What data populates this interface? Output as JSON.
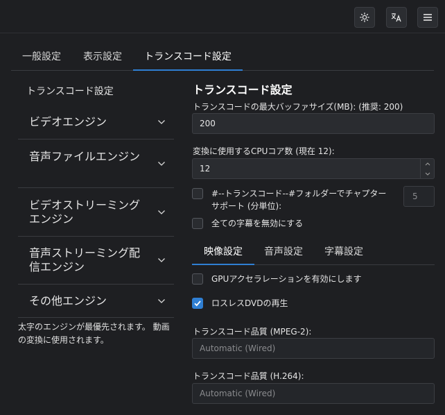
{
  "toolbar": {
    "theme_icon": "sun-icon",
    "language_icon": "translate-icon",
    "menu_icon": "hamburger-menu-icon"
  },
  "main_tabs": [
    {
      "label": "一般設定",
      "active": false
    },
    {
      "label": "表示設定",
      "active": false
    },
    {
      "label": "トランスコード設定",
      "active": true
    }
  ],
  "sidebar": {
    "title": "トランスコード設定",
    "sections": [
      {
        "label": "ビデオエンジン"
      },
      {
        "label": "音声ファイルエンジン"
      },
      {
        "label": "ビデオストリーミングエンジン"
      },
      {
        "label": "音声ストリーミング配信エンジン"
      },
      {
        "label": "その他エンジン"
      }
    ],
    "note": "太字のエンジンが最優先されます。 動画の変換に使用されます。"
  },
  "content": {
    "title": "トランスコード設定",
    "buffer": {
      "label": "トランスコードの最大バッファサイズ(MB): (推奨: 200)",
      "value": "200"
    },
    "cpu": {
      "label": "変換に使用するCPUコア数 (現在 12):",
      "value": "12"
    },
    "chapter": {
      "label": "#--トランスコード--#フォルダーでチャプターサポート (分単位):",
      "value": "5",
      "checked": false
    },
    "disable_subtitles": {
      "label": "全ての字幕を無効にする",
      "checked": false
    },
    "sub_tabs": [
      {
        "label": "映像設定",
        "active": true
      },
      {
        "label": "音声設定",
        "active": false
      },
      {
        "label": "字幕設定",
        "active": false
      }
    ],
    "gpu": {
      "label": "GPUアクセラレーションを有効にします",
      "checked": false
    },
    "lossless_dvd": {
      "label": "ロスレスDVDの再生",
      "checked": true
    },
    "quality_mpeg2": {
      "label": "トランスコード品質 (MPEG-2):",
      "value": "Automatic (Wired)"
    },
    "quality_h264": {
      "label": "トランスコード品質 (H.264):",
      "value": "Automatic (Wired)"
    }
  },
  "colors": {
    "accent": "#2f7fd3",
    "background": "#1e1f22"
  }
}
